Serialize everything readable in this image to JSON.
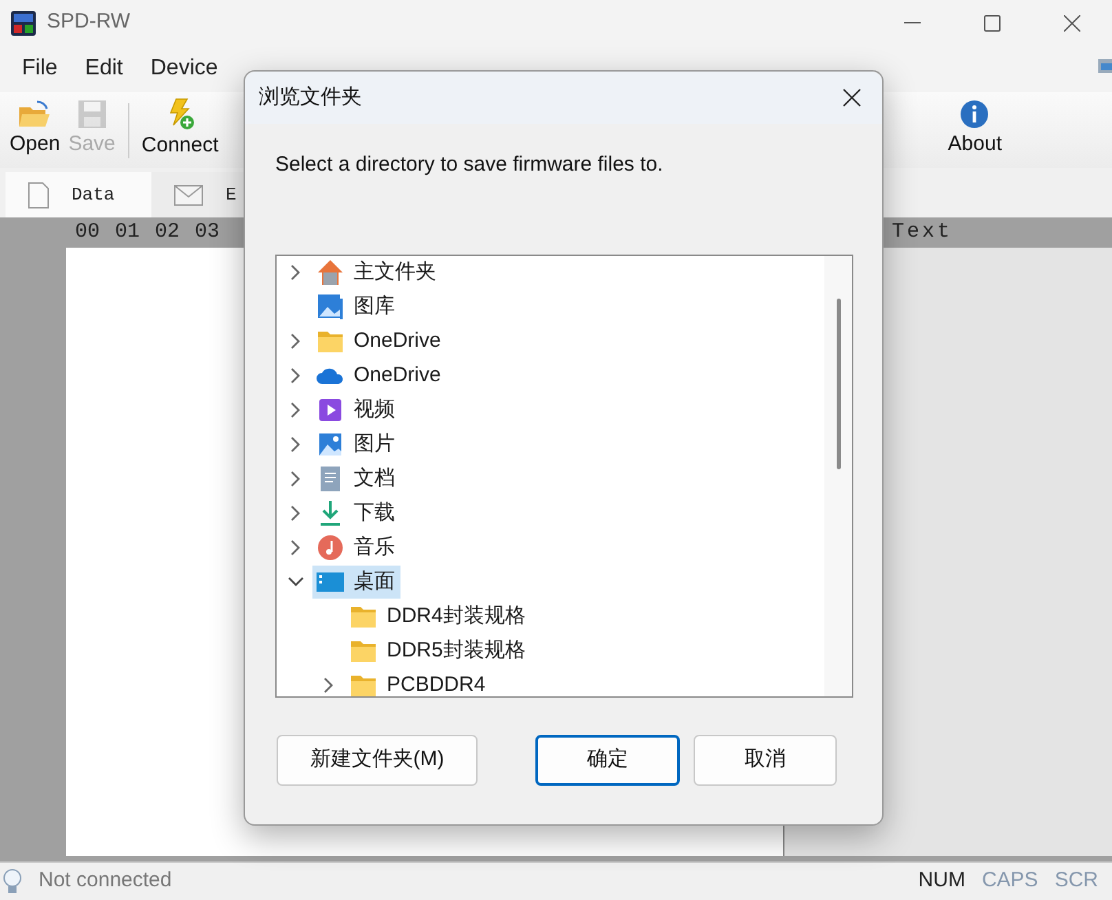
{
  "window": {
    "title": "SPD-RW"
  },
  "menu": [
    "File",
    "Edit",
    "Device"
  ],
  "toolbar": [
    {
      "label": "Open",
      "kind": "open",
      "disabled": false
    },
    {
      "label": "Save",
      "kind": "save",
      "disabled": true
    },
    {
      "label": "Connect",
      "kind": "connect",
      "disabled": false
    },
    {
      "label": "About",
      "kind": "about",
      "disabled": false
    }
  ],
  "tabs": [
    {
      "label": "Data",
      "kind": "page",
      "selected": true
    },
    {
      "label": "E",
      "kind": "mail",
      "selected": false
    }
  ],
  "hex_header": {
    "columns": [
      "00",
      "01",
      "02",
      "03"
    ],
    "text_column": "Text"
  },
  "status_bar": {
    "message": "Not connected",
    "indicators": [
      {
        "label": "NUM",
        "on": true
      },
      {
        "label": "CAPS",
        "on": false
      },
      {
        "label": "SCR",
        "on": false
      }
    ]
  },
  "dialog": {
    "title": "浏览文件夹",
    "prompt": "Select a directory to save firmware files to.",
    "tree": [
      {
        "label": "主文件夹",
        "kind": "home",
        "expandable": true,
        "expanded": false,
        "selected": false
      },
      {
        "label": "图库",
        "kind": "gallery",
        "expandable": false,
        "expanded": false,
        "selected": false
      },
      {
        "label": "OneDrive",
        "kind": "folder",
        "expandable": true,
        "expanded": false,
        "selected": false
      },
      {
        "label": "OneDrive",
        "kind": "cloud",
        "expandable": true,
        "expanded": false,
        "selected": false
      },
      {
        "label": "视频",
        "kind": "video",
        "expandable": true,
        "expanded": false,
        "selected": false
      },
      {
        "label": "图片",
        "kind": "pictures",
        "expandable": true,
        "expanded": false,
        "selected": false
      },
      {
        "label": "文档",
        "kind": "documents",
        "expandable": true,
        "expanded": false,
        "selected": false
      },
      {
        "label": "下载",
        "kind": "download",
        "expandable": true,
        "expanded": false,
        "selected": false
      },
      {
        "label": "音乐",
        "kind": "music",
        "expandable": true,
        "expanded": false,
        "selected": false
      },
      {
        "label": "桌面",
        "kind": "desktop",
        "expandable": true,
        "expanded": true,
        "selected": true,
        "children": [
          {
            "label": "DDR4封装规格",
            "kind": "folder",
            "expandable": false,
            "expanded": false,
            "selected": false
          },
          {
            "label": "DDR5封装规格",
            "kind": "folder",
            "expandable": false,
            "expanded": false,
            "selected": false
          },
          {
            "label": "PCBDDR4",
            "kind": "folder",
            "expandable": true,
            "expanded": false,
            "selected": false
          }
        ]
      }
    ],
    "buttons": [
      {
        "label": "新建文件夹(M)",
        "default": false
      },
      {
        "label": "确定",
        "default": true
      },
      {
        "label": "取消",
        "default": false
      }
    ]
  }
}
